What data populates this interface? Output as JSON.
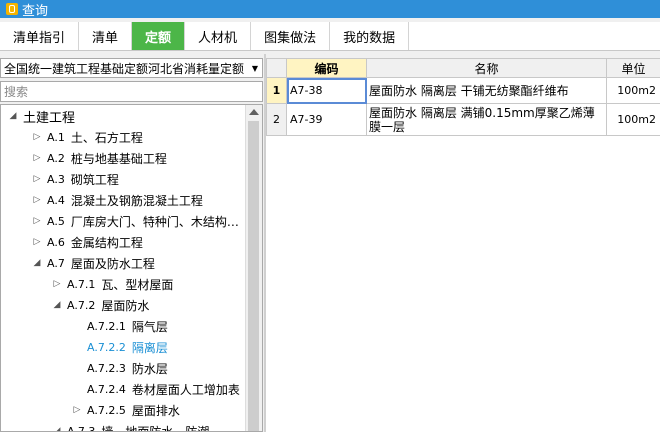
{
  "window": {
    "title": "查询"
  },
  "tabs": [
    {
      "label": "清单指引",
      "active": false
    },
    {
      "label": "清单",
      "active": false
    },
    {
      "label": "定额",
      "active": true
    },
    {
      "label": "人材机",
      "active": false
    },
    {
      "label": "图集做法",
      "active": false
    },
    {
      "label": "我的数据",
      "active": false
    }
  ],
  "quota_library": {
    "selected": "全国统一建筑工程基础定额河北省消耗量定额"
  },
  "search": {
    "placeholder": "搜索",
    "value": ""
  },
  "tree": [
    {
      "code": "",
      "label": "土建工程",
      "expander": "open",
      "level": 0,
      "selected": false
    },
    {
      "code": "A.1",
      "label": "土、石方工程",
      "expander": "closed",
      "level": 1,
      "selected": false
    },
    {
      "code": "A.2",
      "label": "桩与地基基础工程",
      "expander": "closed",
      "level": 1,
      "selected": false
    },
    {
      "code": "A.3",
      "label": "砌筑工程",
      "expander": "closed",
      "level": 1,
      "selected": false
    },
    {
      "code": "A.4",
      "label": "混凝土及钢筋混凝土工程",
      "expander": "closed",
      "level": 1,
      "selected": false
    },
    {
      "code": "A.5",
      "label": "厂库房大门、特种门、木结构…",
      "expander": "closed",
      "level": 1,
      "selected": false
    },
    {
      "code": "A.6",
      "label": "金属结构工程",
      "expander": "closed",
      "level": 1,
      "selected": false
    },
    {
      "code": "A.7",
      "label": "屋面及防水工程",
      "expander": "open",
      "level": 1,
      "selected": false
    },
    {
      "code": "A.7.1",
      "label": "瓦、型材屋面",
      "expander": "closed",
      "level": 2,
      "selected": false
    },
    {
      "code": "A.7.2",
      "label": "屋面防水",
      "expander": "open",
      "level": 2,
      "selected": false
    },
    {
      "code": "A.7.2.1",
      "label": "隔气层",
      "expander": "none",
      "level": 3,
      "selected": false
    },
    {
      "code": "A.7.2.2",
      "label": "隔离层",
      "expander": "none",
      "level": 3,
      "selected": true
    },
    {
      "code": "A.7.2.3",
      "label": "防水层",
      "expander": "none",
      "level": 3,
      "selected": false
    },
    {
      "code": "A.7.2.4",
      "label": "卷材屋面人工增加表",
      "expander": "none",
      "level": 3,
      "selected": false
    },
    {
      "code": "A.7.2.5",
      "label": "屋面排水",
      "expander": "closed",
      "level": 3,
      "selected": false
    },
    {
      "code": "A.7.3",
      "label": "墙、地面防水、防潮",
      "expander": "open",
      "level": 2,
      "selected": false
    }
  ],
  "grid": {
    "headers": {
      "code": "编码",
      "name": "名称",
      "unit": "单位"
    },
    "rows": [
      {
        "num": "1",
        "code": "A7-38",
        "name": "屋面防水 隔离层 干铺无纺聚酯纤维布",
        "unit": "100m2",
        "current": true
      },
      {
        "num": "2",
        "code": "A7-39",
        "name": "屋面防水 隔离层 满铺0.15mm厚聚乙烯薄膜一层",
        "unit": "100m2",
        "current": false
      }
    ]
  },
  "icons": {
    "app": "search-app-icon",
    "dropdown": "chevron-down-icon",
    "expand_closed": "triangle-right-icon",
    "expand_open": "triangle-down-icon",
    "scroll_up": "scroll-up-arrow-icon"
  },
  "colors": {
    "titlebar": "#2f8fd8",
    "active_tab": "#4cb648",
    "selected_tree": "#1a8fd4",
    "active_header": "#fff4c2"
  }
}
